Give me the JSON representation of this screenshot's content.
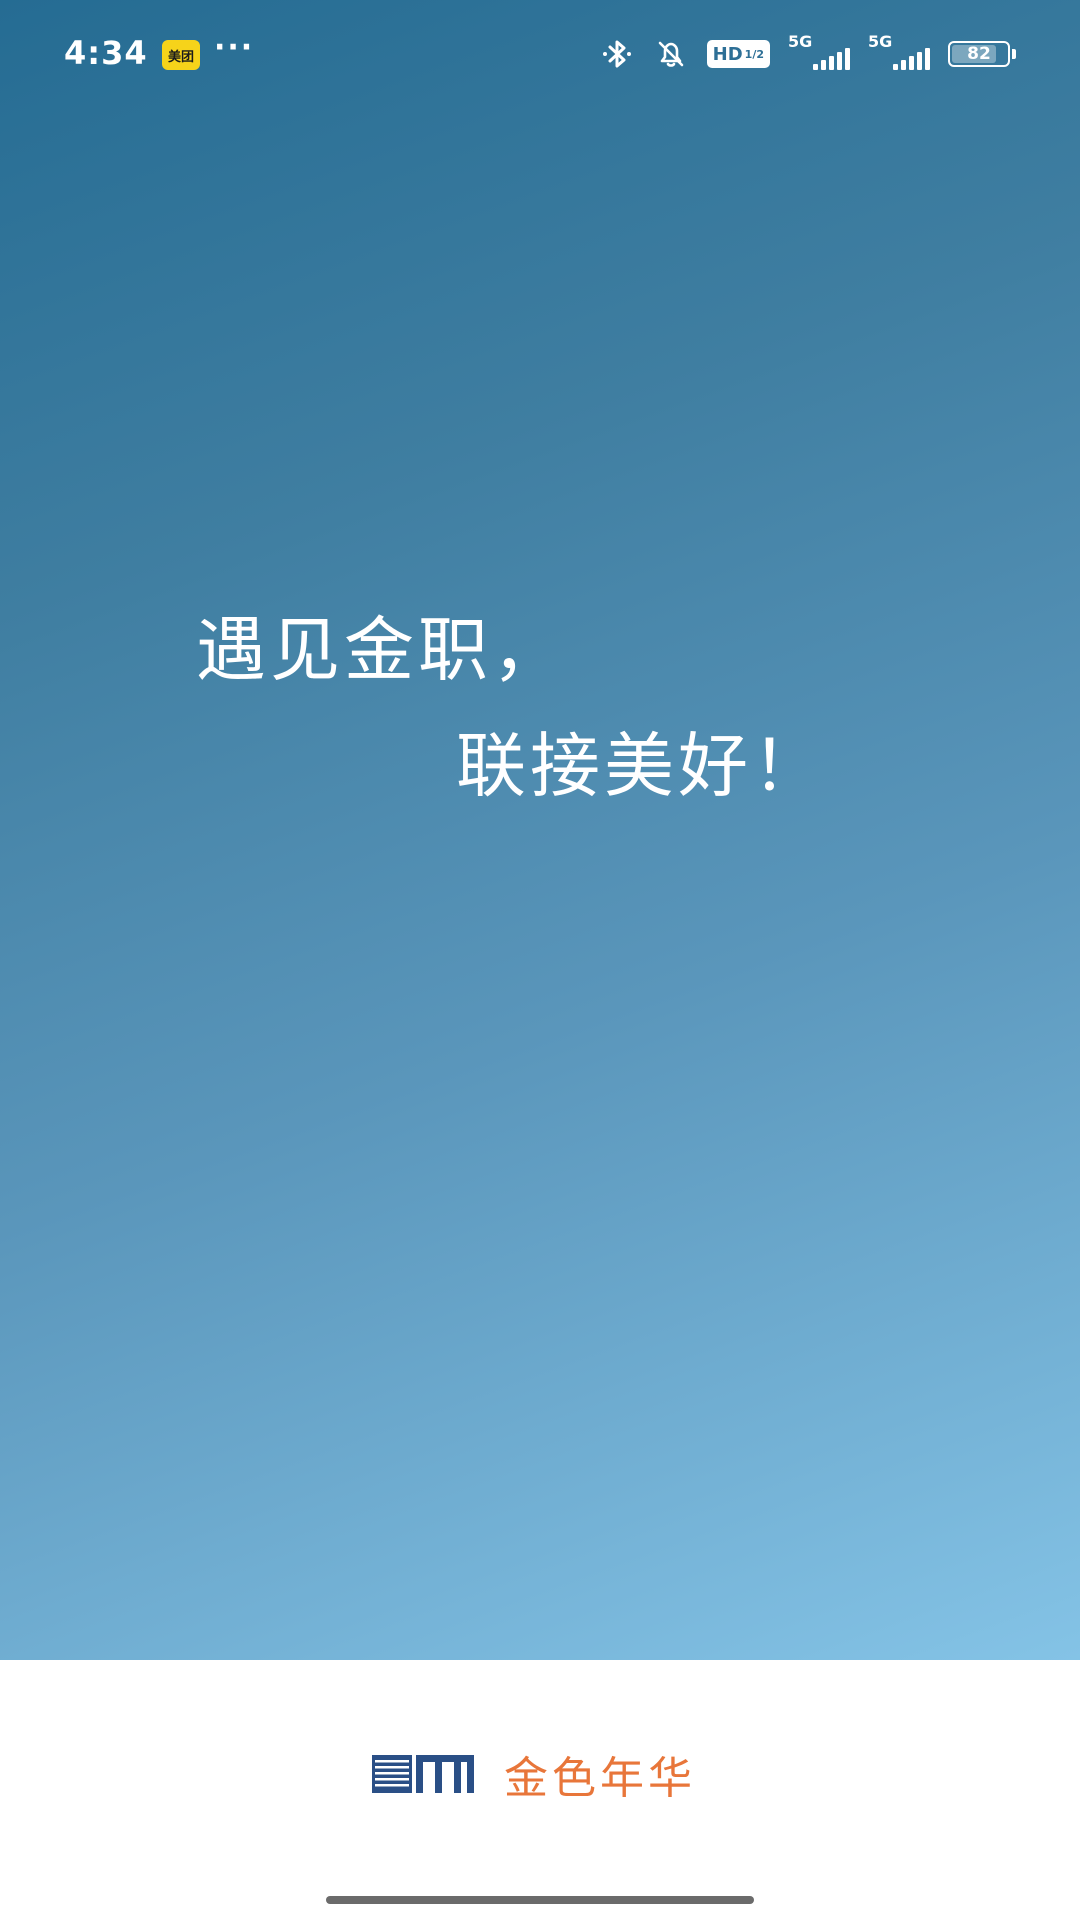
{
  "status_bar": {
    "time": "4:34",
    "app_badge": "美团",
    "more": "···",
    "hd_label": "HD",
    "hd_fraction": "1/2",
    "signal1_label": "5G",
    "signal2_label": "5G",
    "battery_percent": "82",
    "battery_level": 0.82,
    "icons": [
      "bluetooth-icon",
      "mute-bell-icon",
      "hd-voice-icon",
      "signal-5g-icon",
      "signal-5g-icon",
      "battery-icon"
    ]
  },
  "splash": {
    "line1": "遇见金职，",
    "line2": "联接美好！"
  },
  "brand": {
    "name": "金色年华",
    "logo_icon": "brand-logo-icon"
  },
  "colors": {
    "gradient_start": "#256c93",
    "gradient_end": "#84c3e6",
    "brand_orange": "#e8763a",
    "logo_navy": "#2a4f86"
  }
}
